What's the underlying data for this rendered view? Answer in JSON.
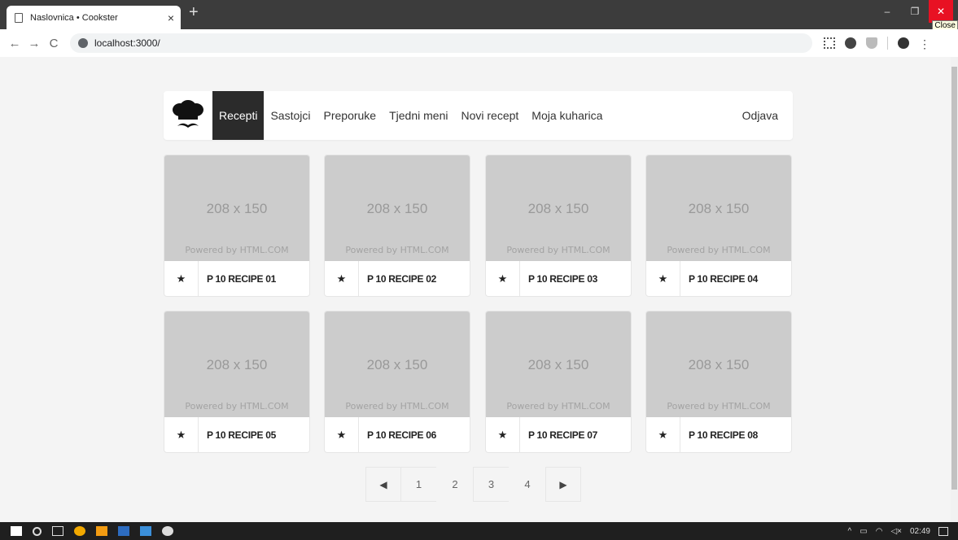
{
  "browser": {
    "tab_title": "Naslovnica • Cookster",
    "tab_close": "×",
    "new_tab": "+",
    "url": "localhost:3000/",
    "back": "←",
    "forward": "→",
    "reload": "C",
    "minimize": "–",
    "restore": "❐",
    "close": "✕",
    "close_tooltip": "Close",
    "menu": "⋮"
  },
  "nav": {
    "items": [
      "Recepti",
      "Sastojci",
      "Preporuke",
      "Tjedni meni",
      "Novi recept",
      "Moja kuharica"
    ],
    "active": "Recepti",
    "logout": "Odjava"
  },
  "recipes": [
    {
      "name": "P 10 RECIPE 01",
      "placeholder": "208 x 150",
      "powered": "Powered by HTML.COM",
      "star": "★"
    },
    {
      "name": "P 10 RECIPE 02",
      "placeholder": "208 x 150",
      "powered": "Powered by HTML.COM",
      "star": "★"
    },
    {
      "name": "P 10 RECIPE 03",
      "placeholder": "208 x 150",
      "powered": "Powered by HTML.COM",
      "star": "★"
    },
    {
      "name": "P 10 RECIPE 04",
      "placeholder": "208 x 150",
      "powered": "Powered by HTML.COM",
      "star": "★"
    },
    {
      "name": "P 10 RECIPE 05",
      "placeholder": "208 x 150",
      "powered": "Powered by HTML.COM",
      "star": "★"
    },
    {
      "name": "P 10 RECIPE 06",
      "placeholder": "208 x 150",
      "powered": "Powered by HTML.COM",
      "star": "★"
    },
    {
      "name": "P 10 RECIPE 07",
      "placeholder": "208 x 150",
      "powered": "Powered by HTML.COM",
      "star": "★"
    },
    {
      "name": "P 10 RECIPE 08",
      "placeholder": "208 x 150",
      "powered": "Powered by HTML.COM",
      "star": "★"
    }
  ],
  "pagination": {
    "prev": "◀",
    "pages": [
      "1",
      "2",
      "3",
      "4"
    ],
    "next": "▶"
  },
  "taskbar": {
    "tray_up": "^",
    "volume": "◁×",
    "time": "02:49"
  },
  "colors": {
    "active_nav": "#2b2b2b",
    "placeholder_bg": "#cccccc",
    "close_button": "#e81123"
  }
}
